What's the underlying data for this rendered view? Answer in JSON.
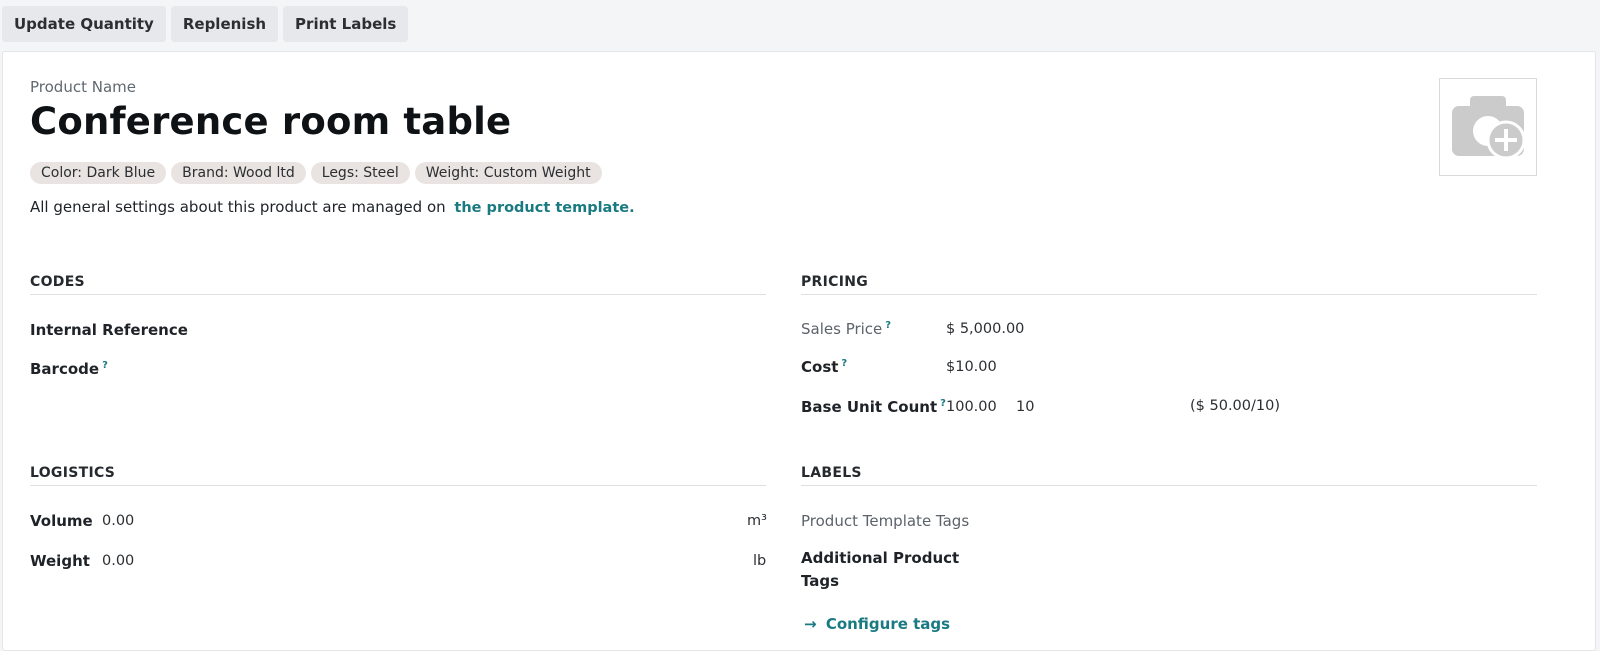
{
  "toolbar": {
    "update_quantity": "Update Quantity",
    "replenish": "Replenish",
    "print_labels": "Print Labels"
  },
  "product": {
    "name_label": "Product Name",
    "name": "Conference room table",
    "attributes": [
      "Color: Dark Blue",
      "Brand: Wood ltd",
      "Legs: Steel",
      "Weight: Custom Weight"
    ],
    "note_text": "All general settings about this product are managed on",
    "note_link": "the product template."
  },
  "codes": {
    "title": "CODES",
    "internal_reference_label": "Internal Reference",
    "barcode_label": "Barcode",
    "help_mark": "?"
  },
  "pricing": {
    "title": "PRICING",
    "sales_price_label": "Sales Price",
    "sales_price": "$ 5,000.00",
    "cost_label": "Cost",
    "cost": "$10.00",
    "base_unit_count_label": "Base Unit Count",
    "base_unit_count": "100.00",
    "base_unit": "10",
    "base_unit_price": "($ 50.00/10)",
    "help_mark": "?"
  },
  "logistics": {
    "title": "LOGISTICS",
    "volume_label": "Volume",
    "volume": "0.00",
    "volume_unit": "m³",
    "weight_label": "Weight",
    "weight": "0.00",
    "weight_unit": "lb"
  },
  "labels": {
    "title": "LABELS",
    "template_tags_label": "Product Template Tags",
    "additional_tags_label_line1": "Additional Product",
    "additional_tags_label_line2": "Tags",
    "configure_arrow": "→",
    "configure_tags": "Configure tags"
  },
  "icons": {
    "photo": "camera-plus-icon",
    "help": "question-mark-icon",
    "arrow": "arrow-right-icon"
  },
  "colors": {
    "link": "#197a82",
    "chip_bg": "#e9e3e1",
    "button_bg": "#e6e8eb"
  }
}
